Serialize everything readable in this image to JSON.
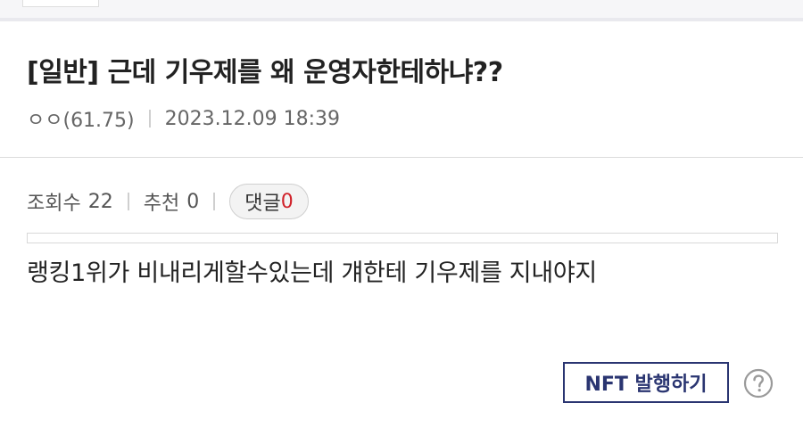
{
  "post": {
    "title": "[일반] 근데 기우제를 왜 운영자한테하냐??",
    "author": "ㅇㅇ(61.75)",
    "datetime": "2023.12.09 18:39",
    "body": "랭킹1위가 비내리게할수있는데 걔한테 기우제를 지내야지"
  },
  "stats": {
    "views_label": "조회수",
    "views": "22",
    "recommend_label": "추천",
    "recommend": "0",
    "comments_label": "댓글",
    "comments": "0"
  },
  "actions": {
    "nft_label": "NFT 발행하기",
    "help_icon": "question-circle-icon"
  },
  "colors": {
    "accent": "#2a3571",
    "comment_count": "#d0222a"
  }
}
